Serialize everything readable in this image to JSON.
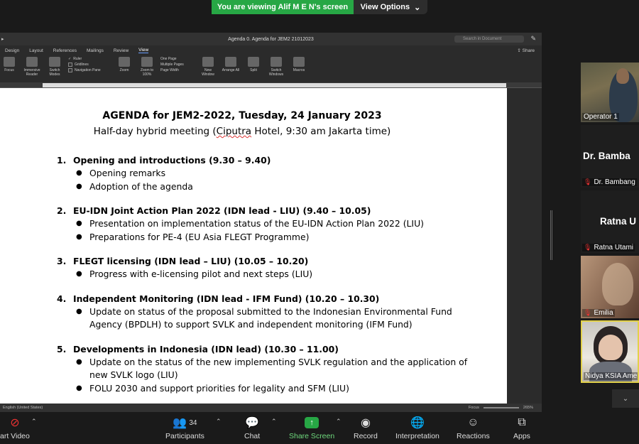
{
  "zoom_banner": {
    "sharing_text": "You are viewing Alif M E N's screen",
    "view_options": "View Options"
  },
  "word": {
    "title": "Agenda 0. Agenda for JEM2 21012023",
    "search_placeholder": "Search in Document",
    "tabs": [
      "Design",
      "Layout",
      "References",
      "Mailings",
      "Review",
      "View"
    ],
    "active_tab": "View",
    "share_label": "Share",
    "ribbon": {
      "buttons_left": [
        "Focus",
        "Immersive Reader",
        "Switch Modes"
      ],
      "checkboxes": [
        "Ruler",
        "Gridlines",
        "Navigation Pane"
      ],
      "zoom_buttons": [
        "Zoom",
        "Zoom to 100%"
      ],
      "page_options": [
        "One Page",
        "Multiple Pages",
        "Page Width"
      ],
      "window_buttons": [
        "New Window",
        "Arrange All",
        "Split"
      ],
      "switch_windows": "Switch Windows",
      "macros": "Macros"
    },
    "status": {
      "language": "English (United States)",
      "focus": "Focus",
      "zoom_level": "265%"
    },
    "document": {
      "heading": "AGENDA for JEM2-2022, Tuesday, 24 January 2023",
      "subheading_before": "Half-day hybrid meeting (",
      "subheading_venue": "Ciputra",
      "subheading_after": " Hotel, 9:30 am Jakarta time)",
      "sections": [
        {
          "num": "1.",
          "title": "Opening and introductions (9.30 – 9.40)",
          "bullets": [
            "Opening remarks",
            "Adoption of the agenda"
          ]
        },
        {
          "num": "2.",
          "title": "EU-IDN Joint Action Plan 2022 (IDN lead - LIU) (9.40 – 10.05)",
          "bullets": [
            "Presentation on implementation status of the EU-IDN Action Plan 2022 (LIU)",
            "Preparations for PE-4 (EU Asia FLEGT Programme)"
          ]
        },
        {
          "num": "3.",
          "title": "FLEGT licensing (IDN lead – LIU) (10.05 – 10.20)",
          "bullets": [
            "Progress with e-licensing pilot and next steps (LIU)"
          ]
        },
        {
          "num": "4.",
          "title": "Independent Monitoring (IDN lead - IFM Fund) (10.20 – 10.30)",
          "bullets": [
            "Update on status of the proposal submitted to the Indonesian Environmental Fund Agency (BPDLH) to support SVLK and independent monitoring (IFM Fund)"
          ]
        },
        {
          "num": "5.",
          "title": "Developments in Indonesia (IDN lead) (10.30 – 11.00)",
          "bullets": [
            "Update on the status of the new implementing SVLK regulation and the application of new SVLK logo (LIU)",
            "FOLU 2030 and support priorities for legality and SFM (LIU)"
          ]
        }
      ]
    }
  },
  "participants_tiles": [
    {
      "name": "Operator 1",
      "big": ""
    },
    {
      "name": "Dr. Bambang",
      "big": "Dr. Bamba"
    },
    {
      "name": "Ratna Utami",
      "big": "Ratna U"
    },
    {
      "name": "Emilia",
      "big": ""
    },
    {
      "name": "Nidya KSIA Ame",
      "big": ""
    }
  ],
  "toolbar": {
    "video": "art Video",
    "participants": "Participants",
    "participants_count": "34",
    "chat": "Chat",
    "share_screen": "Share Screen",
    "record": "Record",
    "interpretation": "Interpretation",
    "reactions": "Reactions",
    "apps": "Apps"
  },
  "colors": {
    "share_green": "#27a745",
    "active_speaker_border": "#e2d14a",
    "muted_red": "#e33333"
  }
}
